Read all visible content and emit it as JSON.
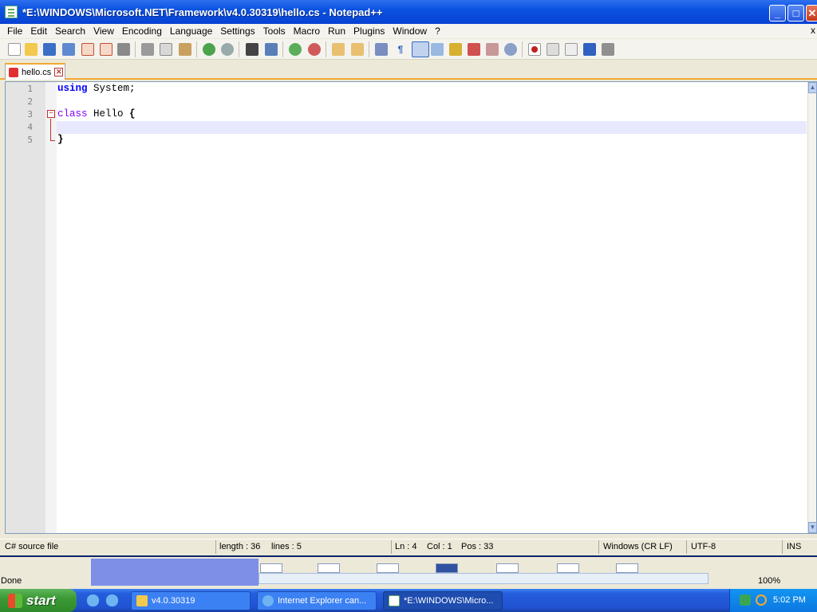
{
  "window": {
    "title": "*E:\\WINDOWS\\Microsoft.NET\\Framework\\v4.0.30319\\hello.cs - Notepad++",
    "min_glyph": "_",
    "max_glyph": "□",
    "close_glyph": "✕"
  },
  "menu": {
    "items": [
      "File",
      "Edit",
      "Search",
      "View",
      "Encoding",
      "Language",
      "Settings",
      "Tools",
      "Macro",
      "Run",
      "Plugins",
      "Window",
      "?"
    ],
    "close_x": "x"
  },
  "tab": {
    "label": "hello.cs"
  },
  "editor": {
    "line_numbers": [
      "1",
      "2",
      "3",
      "4",
      "5"
    ],
    "lines": {
      "l1_kw": "using",
      "l1_rest": " System;",
      "l3_kw": "class",
      "l3_rest": " Hello ",
      "l3_brace": "{",
      "l5_brace": "}"
    },
    "fold_glyph": "−"
  },
  "status": {
    "file_type": "C# source file",
    "length": "length : 36",
    "lines": "lines : 5",
    "ln": "Ln : 4",
    "col": "Col : 1",
    "pos": "Pos : 33",
    "eol": "Windows (CR LF)",
    "encoding": "UTF-8",
    "mode": "INS"
  },
  "ie": {
    "status": "Done",
    "zoom": "100%"
  },
  "taskbar": {
    "start_label": "start",
    "tasks": [
      "v4.0.30319",
      "Internet Explorer can...",
      "*E:\\WINDOWS\\Micro..."
    ],
    "clock": "5:02 PM"
  },
  "colors": {
    "title_bar": "#0842D3",
    "keyword": "#0000FF",
    "class_keyword": "#8000FF",
    "active_tab_accent": "#F4A830",
    "caret_line": "#E8E8FF"
  }
}
